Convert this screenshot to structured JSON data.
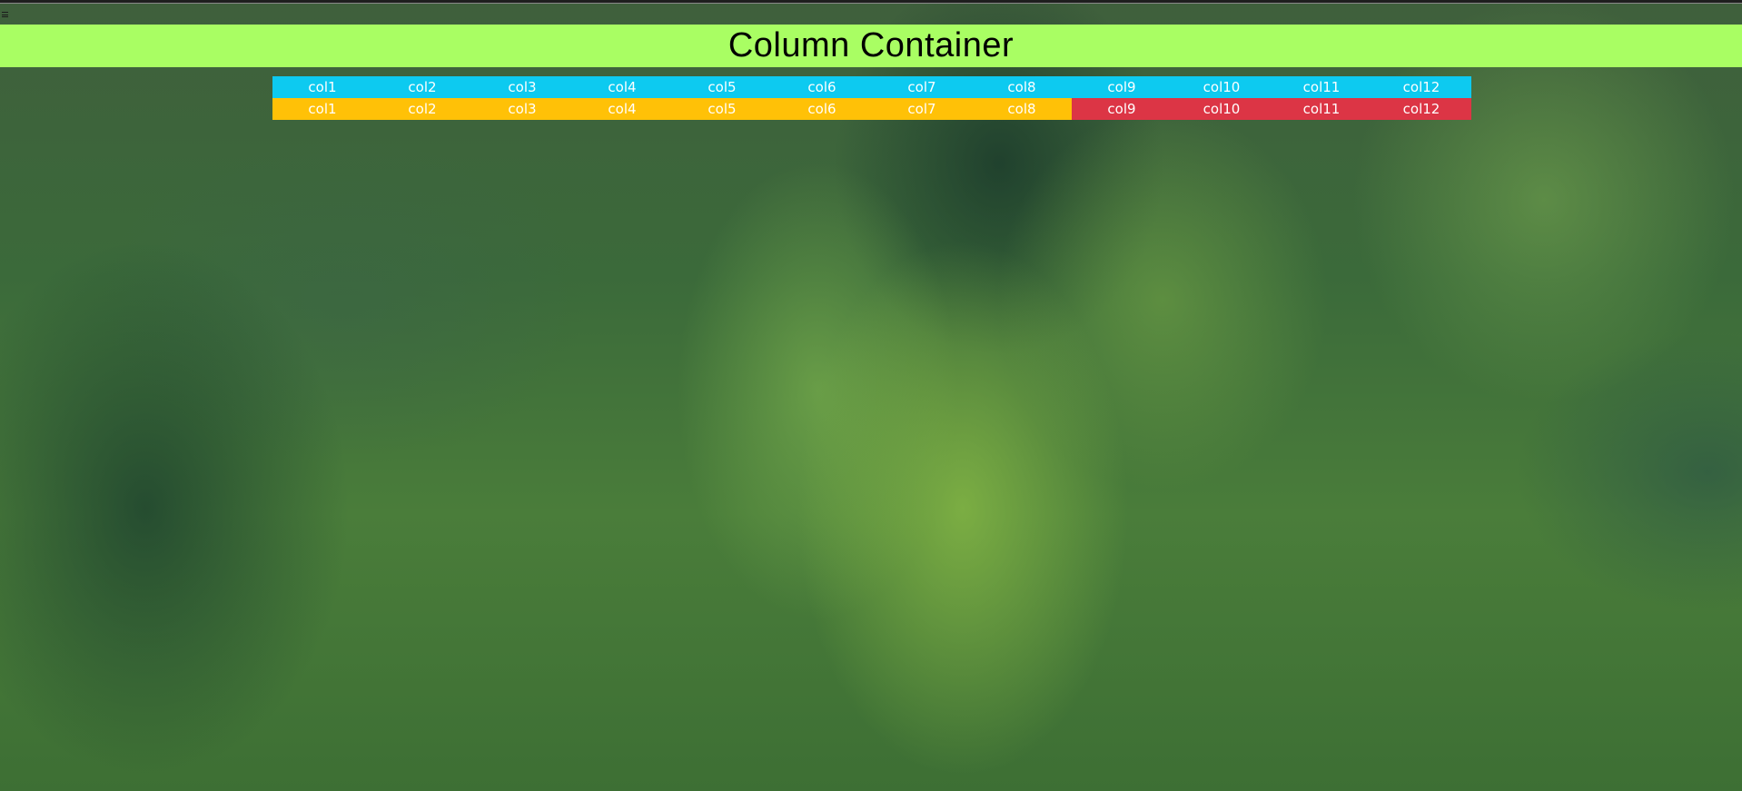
{
  "app": {
    "menu_icon": "hamburger-icon"
  },
  "header": {
    "title": "Column Container",
    "background": "#a9fe63"
  },
  "rows": [
    {
      "color": "#0dcaf0",
      "cells": [
        "col1",
        "col2",
        "col3",
        "col4",
        "col5",
        "col6",
        "col7",
        "col8",
        "col9",
        "col10",
        "col11",
        "col12"
      ],
      "cell_colors": [
        "#0dcaf0",
        "#0dcaf0",
        "#0dcaf0",
        "#0dcaf0",
        "#0dcaf0",
        "#0dcaf0",
        "#0dcaf0",
        "#0dcaf0",
        "#0dcaf0",
        "#0dcaf0",
        "#0dcaf0",
        "#0dcaf0"
      ]
    },
    {
      "color": "#ffc107",
      "cells": [
        "col1",
        "col2",
        "col3",
        "col4",
        "col5",
        "col6",
        "col7",
        "col8",
        "col9",
        "col10",
        "col11",
        "col12"
      ],
      "cell_colors": [
        "#ffc107",
        "#ffc107",
        "#ffc107",
        "#ffc107",
        "#ffc107",
        "#ffc107",
        "#ffc107",
        "#ffc107",
        "#dc3545",
        "#dc3545",
        "#dc3545",
        "#dc3545"
      ]
    }
  ]
}
